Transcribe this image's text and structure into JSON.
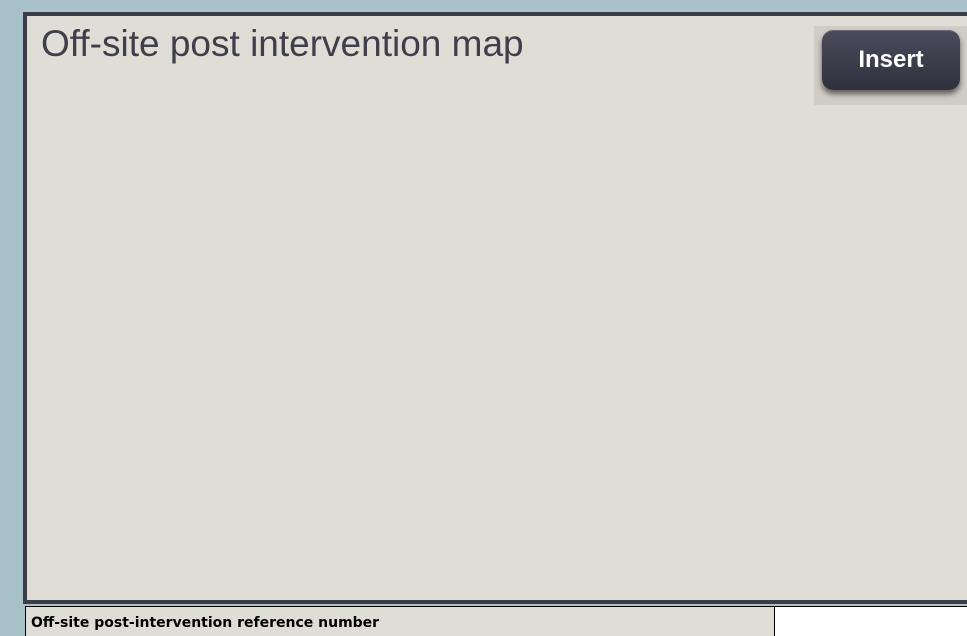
{
  "map_panel": {
    "title": "Off-site post intervention map",
    "insert_label": "Insert"
  },
  "reference": {
    "label": "Off-site post-intervention reference number",
    "value": ""
  },
  "colors": {
    "page_background": "#a9c1c8",
    "panel_background": "#e0dcd6",
    "panel_border": "#3c3d48",
    "button_background": "#3a3a48",
    "button_text": "#ffffff"
  }
}
